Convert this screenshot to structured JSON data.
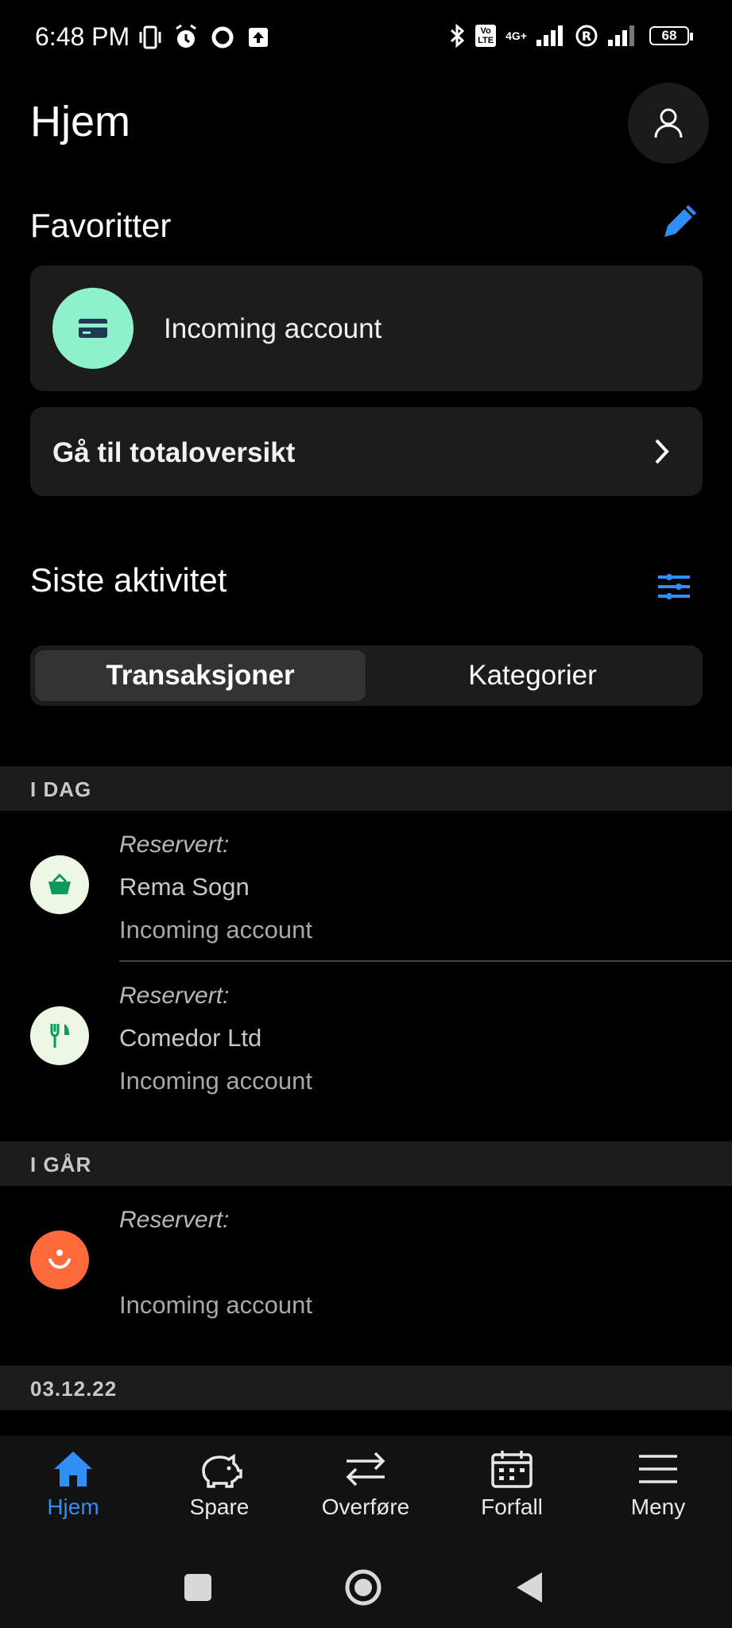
{
  "status_bar": {
    "time": "6:48 PM",
    "network": "4G+",
    "volte": "Vo LTE",
    "battery": "68"
  },
  "header": {
    "title": "Hjem"
  },
  "favorites": {
    "title": "Favoritter",
    "items": [
      {
        "label": "Incoming account"
      }
    ],
    "overview_label": "Gå til totaloversikt"
  },
  "activity": {
    "title": "Siste aktivitet",
    "tabs": [
      {
        "label": "Transaksjoner",
        "active": true
      },
      {
        "label": "Kategorier",
        "active": false
      }
    ],
    "groups": [
      {
        "header": "I DAG",
        "transactions": [
          {
            "status": "Reservert:",
            "name": "Rema Sogn",
            "account": "Incoming account",
            "icon": "basket-icon"
          },
          {
            "status": "Reservert:",
            "name": "Comedor Ltd",
            "account": "Incoming account",
            "icon": "fork-knife-icon"
          }
        ]
      },
      {
        "header": "I GÅR",
        "transactions": [
          {
            "status": "Reservert:",
            "name": "",
            "account": "Incoming account",
            "icon": "smile-icon"
          }
        ]
      },
      {
        "header": "03.12.22",
        "transactions": []
      }
    ]
  },
  "bottom_nav": {
    "items": [
      {
        "label": "Hjem",
        "icon": "home-icon",
        "active": true
      },
      {
        "label": "Spare",
        "icon": "piggy-bank-icon",
        "active": false
      },
      {
        "label": "Overføre",
        "icon": "transfer-arrows-icon",
        "active": false
      },
      {
        "label": "Forfall",
        "icon": "calendar-icon",
        "active": false
      },
      {
        "label": "Meny",
        "icon": "hamburger-menu-icon",
        "active": false
      }
    ]
  },
  "colors": {
    "accent": "#2f8ff5",
    "favorite_avatar": "#8ff1cc",
    "basket_bg": "#eef7e4",
    "smile_bg": "#ff6a3d"
  }
}
